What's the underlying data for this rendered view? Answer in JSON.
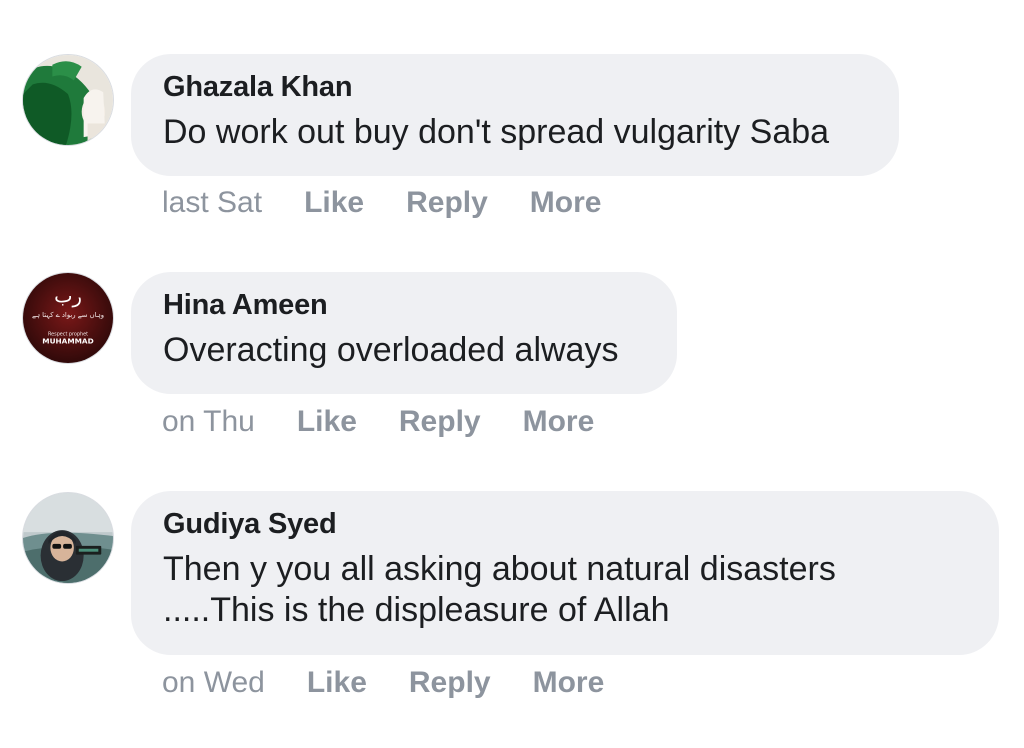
{
  "comments": [
    {
      "author": "Ghazala Khan",
      "text_lines": [
        "Do work out buy don't spread vulgarity Saba"
      ],
      "time": "last Sat",
      "actions": [
        "Like",
        "Reply",
        "More"
      ],
      "avatar_icon": "green-scarf-profile-photo"
    },
    {
      "author": "Hina Ameen",
      "text_lines": [
        "Overacting overloaded always"
      ],
      "time": "on Thu",
      "actions": [
        "Like",
        "Reply",
        "More"
      ],
      "avatar_icon": "respect-prophet-muhammad-badge",
      "avatar_text": {
        "top": "رب",
        "middle": "وہاں سے ربواد ے کہتا ہے",
        "line1": "Respect prophet",
        "line2": "MUHAMMAD"
      }
    },
    {
      "author": "Gudiya Syed",
      "text_lines": [
        "Then y you all asking about natural disasters",
        ".....This is the displeasure of Allah"
      ],
      "time": "on Wed",
      "actions": [
        "Like",
        "Reply",
        "More"
      ],
      "avatar_icon": "woman-with-sunglasses-photo"
    }
  ]
}
